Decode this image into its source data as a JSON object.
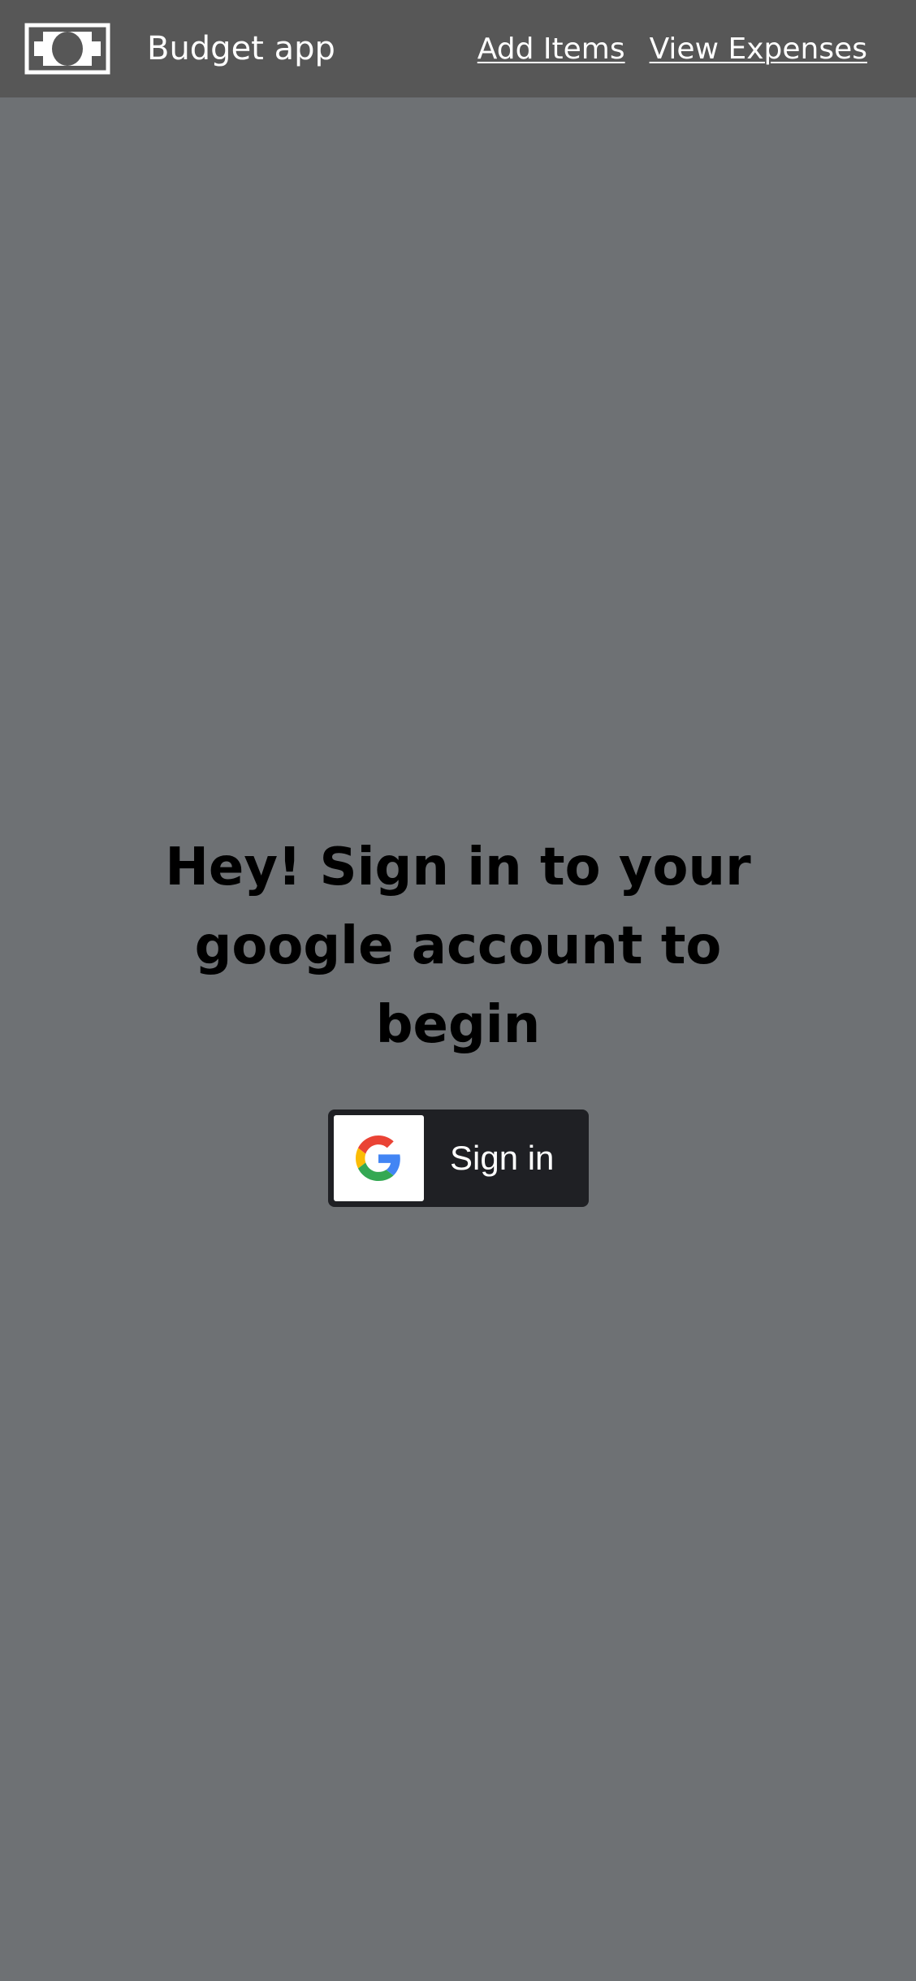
{
  "navbar": {
    "logo_icon": "money-bill-icon",
    "brand": "Budget app",
    "links": [
      {
        "label": "Add Items"
      },
      {
        "label": "View Expenses"
      }
    ]
  },
  "hero": {
    "heading": "Hey! Sign in to your google account to begin"
  },
  "signin": {
    "icon": "google-icon",
    "label": "Sign in"
  },
  "colors": {
    "page_background": "#6e7174",
    "navbar_background": "#575757",
    "button_background": "#1f2024",
    "text_dark": "#000000",
    "text_light": "#ffffff"
  }
}
